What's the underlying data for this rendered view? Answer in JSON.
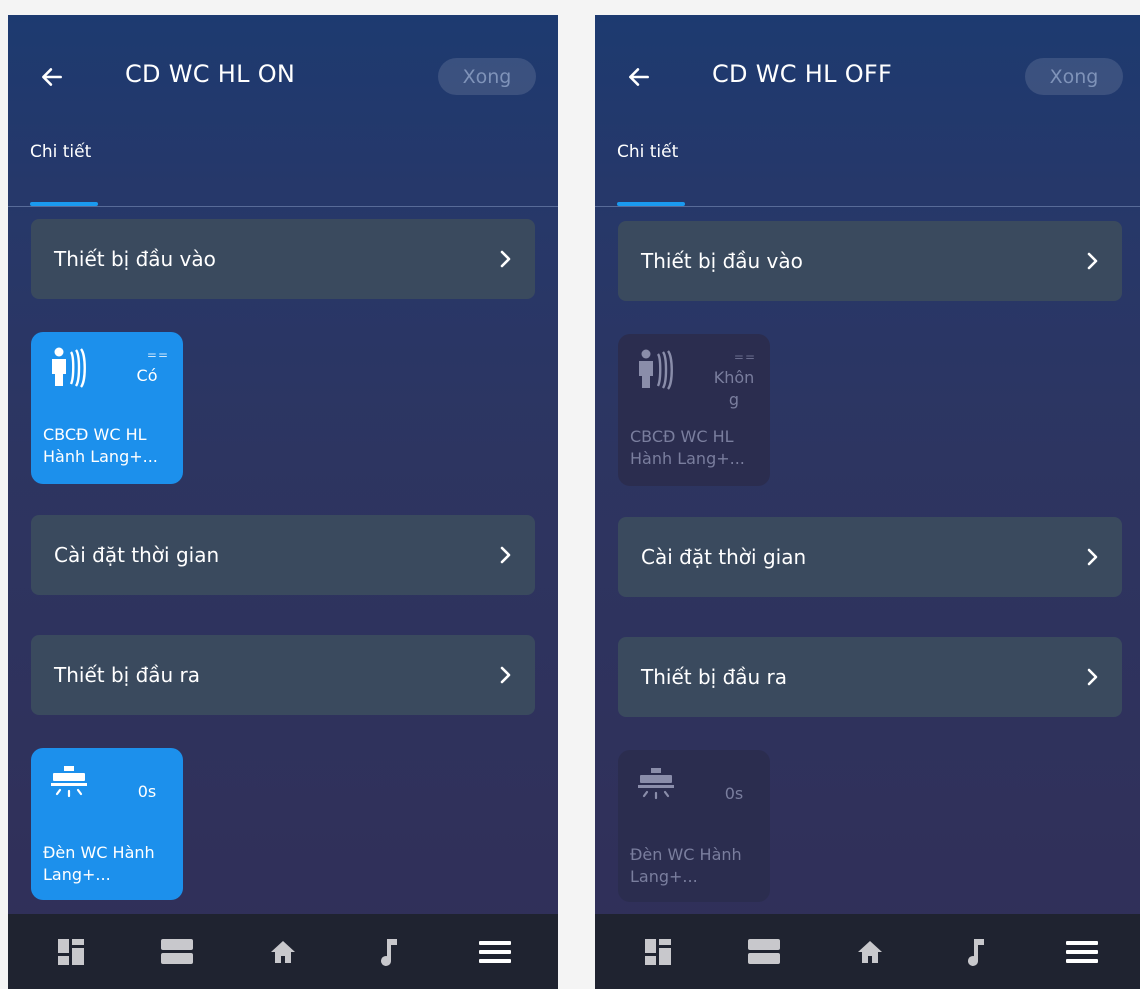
{
  "screens": [
    {
      "title": "CD WC HL ON",
      "done_label": "Xong",
      "tab_label": "Chi tiết",
      "input_row_label": "Thiết bị đầu vào",
      "time_row_label": "Cài đặt thời gian",
      "output_row_label": "Thiết bị đầu ra",
      "input_tile": {
        "icon": "motion-sensor-icon",
        "operator": "==",
        "value": "Có",
        "name": "CBCĐ WC HL Hành Lang+...",
        "state": "active"
      },
      "output_tile": {
        "icon": "ceiling-light-icon",
        "value": "0s",
        "name": "Đèn WC Hành Lang+...",
        "state": "active"
      }
    },
    {
      "title": "CD WC HL OFF",
      "done_label": "Xong",
      "tab_label": "Chi tiết",
      "input_row_label": "Thiết bị đầu vào",
      "time_row_label": "Cài đặt thời gian",
      "output_row_label": "Thiết bị đầu ra",
      "input_tile": {
        "icon": "motion-sensor-icon",
        "operator": "==",
        "value": "Không",
        "name": "CBCĐ WC HL Hành Lang+...",
        "state": "inactive"
      },
      "output_tile": {
        "icon": "ceiling-light-icon",
        "value": "0s",
        "name": "Đèn WC Hành Lang+...",
        "state": "inactive"
      }
    }
  ],
  "bottom_nav": [
    {
      "icon": "dashboard-icon"
    },
    {
      "icon": "rooms-icon"
    },
    {
      "icon": "home-icon"
    },
    {
      "icon": "music-icon"
    },
    {
      "icon": "menu-icon"
    }
  ],
  "colors": {
    "accent": "#1c90ec",
    "tab_indicator": "#1a9af0",
    "row_bg": "#3a4a5e",
    "inactive_tile": "#2b2d4f",
    "navbar_bg": "#1f2330"
  }
}
